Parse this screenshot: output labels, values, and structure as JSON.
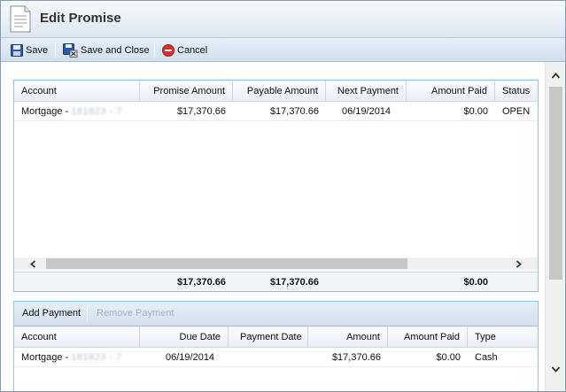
{
  "window": {
    "title": "Edit Promise",
    "icons": {
      "title": "document-icon"
    }
  },
  "toolbar": {
    "save_label": "Save",
    "save_close_label": "Save and Close",
    "cancel_label": "Cancel",
    "icons": {
      "save": "floppy-disk-icon",
      "save_close": "save-close-icon",
      "cancel": "cancel-icon"
    }
  },
  "promise_grid": {
    "columns": [
      "Account",
      "Promise Amount",
      "Payable Amount",
      "Next Payment",
      "Amount Paid",
      "Status"
    ],
    "rows": [
      {
        "account_prefix": "Mortgage - ",
        "account_masked": "181823 - 7",
        "promise_amount": "$17,370.66",
        "payable_amount": "$17,370.66",
        "next_payment": "06/19/2014",
        "amount_paid": "$0.00",
        "status": "OPEN"
      }
    ],
    "totals": {
      "promise_amount": "$17,370.66",
      "payable_amount": "$17,370.66",
      "amount_paid": "$0.00"
    }
  },
  "payments_grid": {
    "add_label": "Add Payment",
    "remove_label": "Remove Payment",
    "columns": [
      "Account",
      "Due Date",
      "Payment Date",
      "Amount",
      "Amount Paid",
      "Type"
    ],
    "rows": [
      {
        "account_prefix": "Mortgage - ",
        "account_masked": "181823 - 7",
        "due_date": "06/19/2014",
        "payment_date": "",
        "amount": "$17,370.66",
        "amount_paid": "$0.00",
        "type": "Cash"
      }
    ]
  },
  "colors": {
    "grid_border": "#99bbe8",
    "toolbar_bg": "#d3dfee",
    "cancel_red": "#d9302c",
    "save_blue": "#2a5aa8"
  }
}
